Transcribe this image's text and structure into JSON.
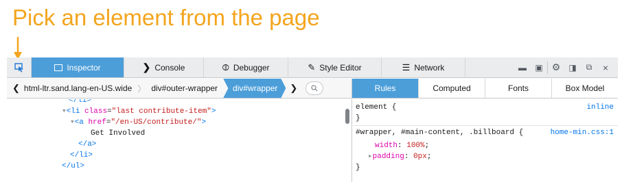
{
  "annotation": {
    "text": "Pick an element from the page",
    "color": "#f3a51e"
  },
  "toolbar": {
    "pick_icon": "element-picker-icon",
    "tabs": [
      {
        "label": "Inspector",
        "icon": "inspector-icon",
        "selected": true
      },
      {
        "label": "Console",
        "icon": "console-icon",
        "selected": false
      },
      {
        "label": "Debugger",
        "icon": "debugger-icon",
        "selected": false
      },
      {
        "label": "Style Editor",
        "icon": "style-editor-icon",
        "selected": false
      },
      {
        "label": "Network",
        "icon": "network-icon",
        "selected": false
      }
    ],
    "close_glyph": "×"
  },
  "breadcrumbs": [
    "html-ltr.sand.lang-en-US.wide",
    "div#outer-wrapper",
    "div#wrapper"
  ],
  "sidebar_tabs": [
    "Rules",
    "Computed",
    "Fonts",
    "Box Model"
  ],
  "markup": {
    "lines": [
      {
        "indent": 6,
        "text": "</li>"
      },
      {
        "indent": 4,
        "open": "<li",
        "attr": "class",
        "val": "\"last contribute-item\"",
        "close": ">"
      },
      {
        "indent": 6,
        "open": "<a",
        "attr": "href",
        "val": "\"/en-US/contribute/\"",
        "close": ">"
      },
      {
        "indent": 8,
        "text": "Get Involved"
      },
      {
        "indent": 6,
        "text": "</a>"
      },
      {
        "indent": 4,
        "text": "</li>"
      },
      {
        "indent": 2,
        "text": "</ul>"
      }
    ]
  },
  "rules": {
    "element_selector": "element {",
    "element_source": "inline",
    "close_brace": "}",
    "wrapper_selector": "#wrapper, #main-content, .billboard {",
    "wrapper_source": "home-min.css:1",
    "decls": [
      {
        "prop": "width",
        "value": "100%"
      },
      {
        "prop": "padding",
        "value": "0px"
      }
    ]
  }
}
